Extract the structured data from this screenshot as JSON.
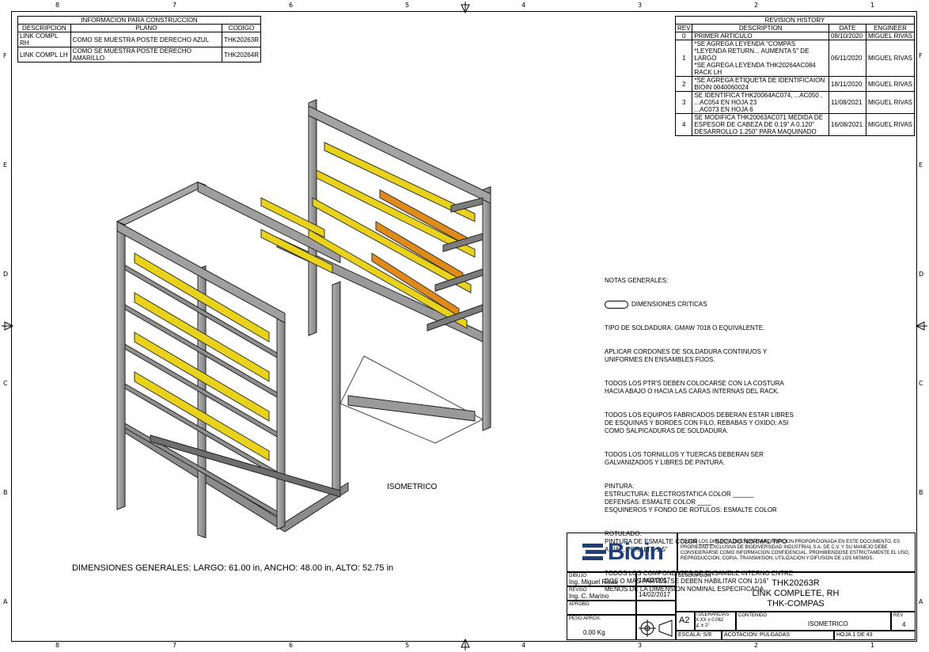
{
  "zones": {
    "top": [
      "8",
      "7",
      "6",
      "5",
      "4",
      "3",
      "2",
      "1"
    ],
    "side": [
      "F",
      "E",
      "D",
      "C",
      "B",
      "A"
    ]
  },
  "construction_info": {
    "title": "INFORMACION PARA CONSTRUCCION",
    "headers": [
      "DESCRIPCION",
      "PLANO",
      "CODIGO"
    ],
    "rows": [
      [
        "LINK COMPL RH",
        "COMO SE MUESTRA POSTE DERECHO AZUL",
        "THK20263R"
      ],
      [
        "LINK COMPL LH",
        "COMO SE MUESTRA POSTE DERECHO AMARILLO",
        "THK20264R"
      ]
    ]
  },
  "revision_history": {
    "title": "REVISION HISTORY",
    "headers": [
      "REV",
      "DESCRIPTION",
      "DATE",
      "ENGINEER"
    ],
    "rows": [
      {
        "rev": "0",
        "desc": "PRIMER ARTICULO",
        "date": "08/10/2020",
        "eng": "MIGUEL RIVAS"
      },
      {
        "rev": "1",
        "desc": "*SE AGREGA LEYENDA \"COMPAS\n*LEYENDA RETURN... AUMENTA 5\" DE LARGO\n*SE AGREGA LEYENDA THK20264AC084\nRACK LH",
        "date": "06/11/2020",
        "eng": "MIGUEL RIVAS"
      },
      {
        "rev": "2",
        "desc": "*SE AGREGA ETIQUETA DE IDENTIFICAION\nBIOIN 0040060024",
        "date": "18/11/2020",
        "eng": "MIGUEL RIVAS"
      },
      {
        "rev": "3",
        "desc": "SE IDENTIFICA THK20064AC074, ...AC050 ,\n...AC054 EN HOJA 23\n...AC073 EN HOJA 6",
        "date": "11/08/2021",
        "eng": "MIGUEL RIVAS"
      },
      {
        "rev": "4",
        "desc": "SE MODIFICA THK20063AC071 MEDIDA DE\nESPESOR DE CABEZA DE 0.19\" A 0.120\"\nDESARROLLO 1.250\" PARA MAQUINADO",
        "date": "16/08/2021",
        "eng": "MIGUEL RIVAS"
      }
    ]
  },
  "notes": {
    "title": "NOTAS GENERALES:",
    "critical": "DIMENSIONES CRITICAS",
    "items": [
      "TIPO DE SOLDADURA: GMAW 7018 O EQUIVALENTE.",
      "APLICAR CORDONES DE SOLDADURA CONTINUOS Y\nUNIFORMES EN ENSAMBLES FIJOS.",
      "TODOS LOS PTR'S DEBEN COLOCARSE CON LA COSTURA\nHACIA ABAJO O HACIA LAS CARAS INTERNAS DEL RACK.",
      "TODOS LOS EQUIPOS FABRICADOS DEBERAN ESTAR LIBRES\nDE ESQUINAS Y BORDES CON FILO, REBABAS Y OXIDO; ASI\nCOMO SALPICADURAS DE SOLDADURA.",
      "TODOS LOS TORNILLOS Y TUERCAS DEBERAN SER\nGALVANIZADOS Y LIBRES DE PINTURA.",
      "PINTURA:\nESTRUCTURA: ELECTROSTATICA COLOR ______\nDEFENSAS: ESMALTE COLOR ____\nESQUINEROS Y FONDO DE ROTULOS: ESMALTE COLOR",
      "ROTULADO:\nPINTURA DE ESMALTE COLOR ____ SECADO NORMAL TIPO\nARIAL, PERALTE 1.5\"",
      "TODOS LOS COMPONENTES DE ENSAMBLE INTERNO ENTRE\nDOS O MÁS PARTES, SE DEBEN HABILITAR CON 1/16\"\nMENOS DE LA DIMENSION NOMINAL ESPECIFICADA."
    ]
  },
  "view_label": "ISOMETRICO",
  "dimensions": "DIMENSIONES GENERALES: LARGO: 61.00 in, ANCHO: 48.00 in, ALTO: 52.75 in",
  "title_block": {
    "logo": "Bioin",
    "disclaimer": "TODOS LOS DIBUJOS, DISEÑOS E INFORMACION PROPORCIONADA EN ESTE DOCUMENTO, ES PROPIEDAD EXCLUSIVA DE BIODIVERSIDAD INDUSTRIAL S.A. DE C.V. Y SU MANEJO DEBE CONSIDERARSE COMO INFORMACION CONFIDENCIAL, PROHIBIENDOSE ESTRICTAMENTE EL USO, REPRODUCCION, COPIA, TRANSMISION, UTILIZACION Y DIFUSION DE LOS MISMOS.",
    "drew_label": "DIBUJÓ",
    "drew_name": "Ing. Miguel Rivas",
    "drew_date": "14/02/2017",
    "reviewed_label": "REVISÓ",
    "reviewed_name": "Ing. C. Marino",
    "reviewed_date": "14/02/2017",
    "approved_label": "APROBÓ",
    "desc_label": "DESCRIPCION",
    "desc_line1": "THK20263R",
    "desc_line2": "LINK COMPLETE, RH",
    "desc_line3": "THK-COMPAS",
    "weight_label": "PESO APROX.",
    "weight": "0.00 Kg",
    "size": "A2",
    "tol_label": "TOLERANCIAS",
    "tol1": "X.XX ± 0.062",
    "tol2": "∠ ± 2°",
    "content_label": "CONTENIDO",
    "content": "ISOMETRICO",
    "rev_label": "REV",
    "rev": "4",
    "scale": "ESCALA: S/E",
    "units": "ACOTACION: PULGADAS",
    "sheet": "HOJA 1  DE 43"
  },
  "colors": {
    "steel": "#9a9a9a",
    "steel_dark": "#5e5e5e",
    "yellow": "#e8d21c",
    "orange": "#e08a1a",
    "logo": "#1e3f7a"
  }
}
